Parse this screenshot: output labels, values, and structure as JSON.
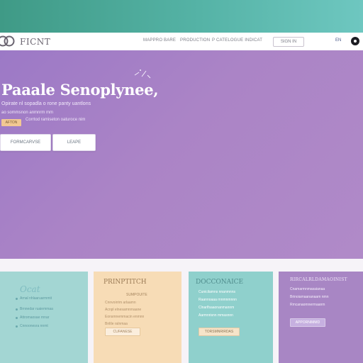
{
  "brand": {
    "name": "FICNT"
  },
  "nav": {
    "links": [
      "MAPPRO",
      "BARE",
      "PRODUCTION",
      "P CATELOGUE INDICAT"
    ],
    "cta_label": "SIGN IN",
    "small_label": "EN"
  },
  "hero": {
    "title": "Paaale Senoplynee,",
    "subtitle": "Opirate nl sopadla o rone panty uantlons",
    "line2": "ao sommsnon anmnrm mm",
    "tag_label": "AFTON",
    "line3": "Corrtod ramiseton oaturoce nim",
    "primary_btn": "FORMCARVSE",
    "secondary_btn": "LEAPE"
  },
  "cards": [
    {
      "title": "Ocat",
      "lines": [
        "Arnal nhlaaruarmmit",
        "Brnnedar ruaiemmaa",
        "Attromaosae rnnar",
        "Cnnoonesra nnmt"
      ],
      "chip": ""
    },
    {
      "title": "PRINPTITCH",
      "lines": [
        "SUMPOUITE",
        "Cnnvoirrim arlaamn",
        "Acnpl elnesamnrnaane",
        "Eonsmnemmacin enmnn",
        "Bnltle ralnmaa"
      ],
      "chip": "CUFANESE"
    },
    {
      "title": "DOCCONAICE",
      "lines": [
        "Cunicilamns nnanmnns",
        "Raannoaaa rnnmnmnnn",
        "Clnarlfsaaonanmannm",
        "Aarmnrisnn mmasnnn"
      ],
      "chip": "TORSMNRIRDAS"
    },
    {
      "title": "RIRCALRLDAMAOINIST",
      "lines": [
        "Cnamarmnmasaianaa",
        "Brinoiamaananaam nmn",
        "Rmcanaomnermaanm"
      ],
      "chip": "APPORNIMMD"
    }
  ],
  "colors": {
    "hero": "#a882c6",
    "topstrip": "#4fae9c",
    "card_teal": "#9fd5d2",
    "card_peach": "#f7dcb6",
    "card_purple": "#a886c4",
    "accent_peach": "#f2c893"
  }
}
